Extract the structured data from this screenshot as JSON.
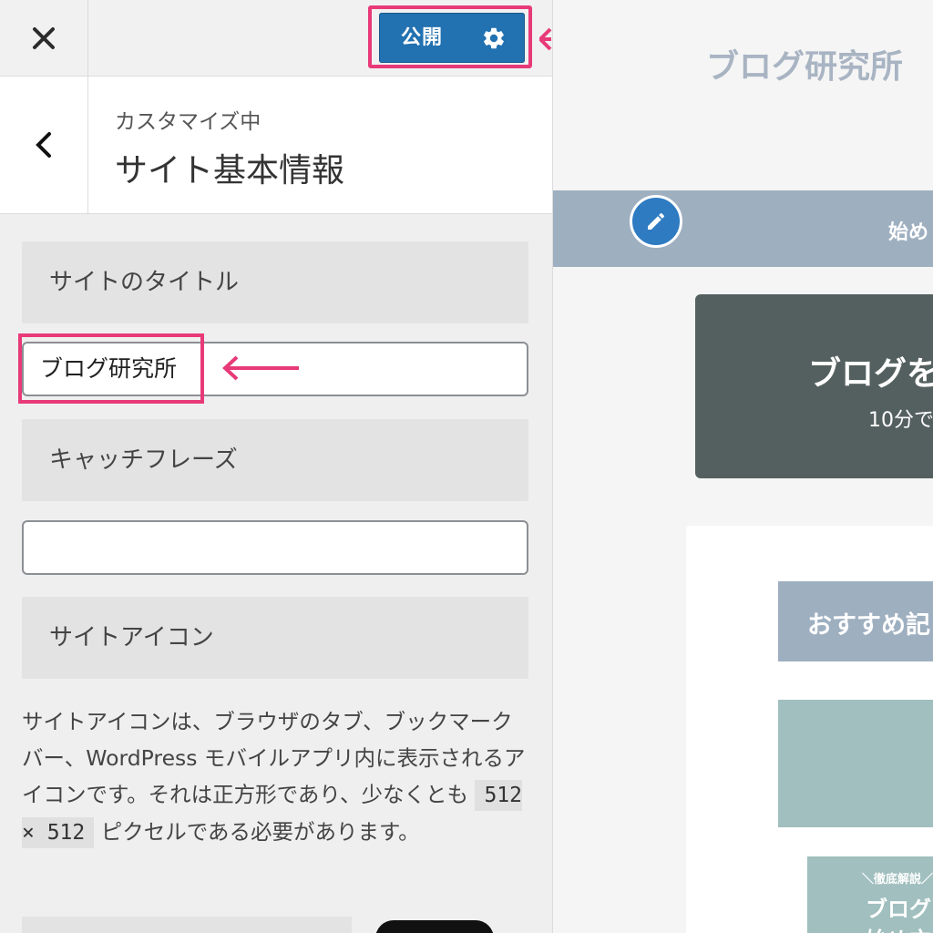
{
  "topbar": {
    "close_icon": "close-icon",
    "publish_label": "公開",
    "settings_icon": "gear-icon"
  },
  "section": {
    "customizing_label": "カスタマイズ中",
    "title": "サイト基本情報",
    "back_icon": "chevron-left-icon"
  },
  "controls": {
    "site_title_heading": "サイトのタイトル",
    "site_title_value": "ブログ研究所",
    "tagline_heading": "キャッチフレーズ",
    "tagline_value": "",
    "site_icon_heading": "サイトアイコン",
    "site_icon_desc_1": "サイトアイコンは、ブラウザのタブ、ブックマークバー、WordPress モバイルアプリ内に表示されるアイコンです。それは正方形であり、少なくとも ",
    "site_icon_desc_code": "512 × 512",
    "site_icon_desc_2": " ピクセルである必要があります。"
  },
  "preview": {
    "site_title": "ブログ研究所",
    "nav_text": "始め",
    "hero_title": "ブログを",
    "hero_sub": "10分で",
    "recommend_header": "おすすめ記",
    "thumb_tag": "＼徹底解説／",
    "thumb_title": "ブログ",
    "thumb_title2": "始め方"
  },
  "colors": {
    "accent": "#2271b1",
    "highlight": "#e83a78",
    "nav": "#9eafc0",
    "hero": "#54605f"
  }
}
